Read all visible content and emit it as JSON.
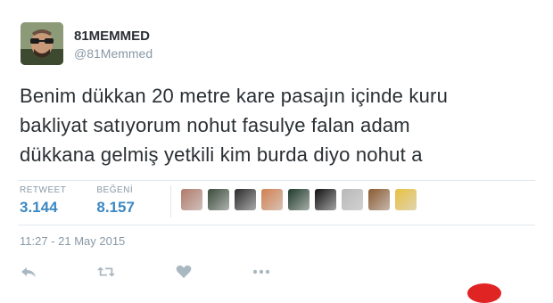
{
  "tweet": {
    "display_name": "81MEMMED",
    "handle": "@81Memmed",
    "text": "Benim dükkan 20 metre kare pasajın içinde kuru\nbakliyat satıyorum nohut fasulye falan adam\ndükkana gelmiş yetkili kim burda diyo nohut a",
    "retweet_label": "RETWEET",
    "retweet_count": "3.144",
    "like_label": "BEĞENİ",
    "like_count": "8.157",
    "timestamp": "11:27 - 21 May 2015",
    "accent_color": "#3b88c3",
    "muted_color": "#8899a6"
  },
  "likers": [
    {
      "icon": "liker-avatar",
      "color": "#b07a6a"
    },
    {
      "icon": "liker-avatar",
      "color": "#3a4a3a"
    },
    {
      "icon": "liker-avatar",
      "color": "#2a2a2a"
    },
    {
      "icon": "liker-avatar",
      "color": "#d08050"
    },
    {
      "icon": "liker-avatar",
      "color": "#1f3a2a"
    },
    {
      "icon": "liker-avatar",
      "color": "#111111"
    },
    {
      "icon": "liker-avatar",
      "color": "#b8b8b8"
    },
    {
      "icon": "liker-avatar",
      "color": "#8a5a30"
    },
    {
      "icon": "liker-avatar",
      "color": "#e8c040"
    }
  ],
  "actions": [
    {
      "icon": "reply-icon"
    },
    {
      "icon": "retweet-icon"
    },
    {
      "icon": "heart-icon"
    },
    {
      "icon": "more-icon"
    }
  ]
}
